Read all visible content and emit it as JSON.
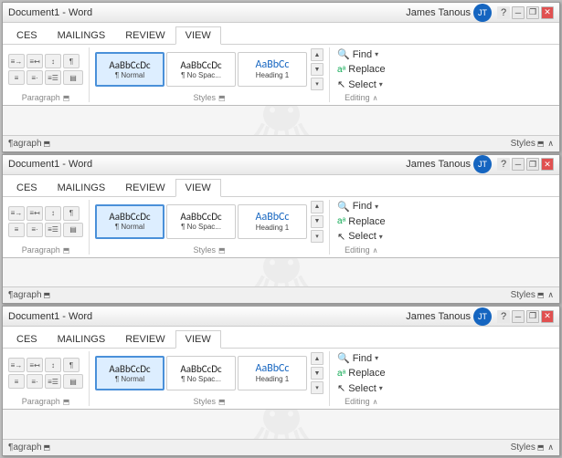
{
  "windows": [
    {
      "id": "window1",
      "title": "Document1 - Word",
      "user": "James Tanous",
      "tabs": [
        "CES",
        "MAILINGS",
        "REVIEW",
        "VIEW"
      ],
      "activeTab": "VIEW",
      "styles": [
        {
          "label": "¶ Normal",
          "sample": "AaBbCcDc",
          "active": true
        },
        {
          "label": "¶ No Spac...",
          "sample": "AaBbCcDc",
          "active": false
        },
        {
          "label": "Heading 1",
          "sample": "AaBbCc",
          "active": false
        }
      ],
      "editing": {
        "find": "🔍 Find",
        "replace": "Replace",
        "select": "Select"
      },
      "statusLeft": "¶agraph",
      "statusRight": "Styles"
    },
    {
      "id": "window2",
      "title": "Document1 - Word",
      "user": "James Tanous",
      "tabs": [
        "CES",
        "MAILINGS",
        "REVIEW",
        "VIEW"
      ],
      "activeTab": "VIEW",
      "styles": [
        {
          "label": "¶ Normal",
          "sample": "AaBbCcDc",
          "active": true
        },
        {
          "label": "¶ No Spac...",
          "sample": "AaBbCcDc",
          "active": false
        },
        {
          "label": "Heading 1",
          "sample": "AaBbCc",
          "active": false
        }
      ],
      "editing": {
        "find": "🔍 Find",
        "replace": "Replace",
        "select": "Select"
      },
      "statusLeft": "¶agraph",
      "statusRight": "Styles"
    },
    {
      "id": "window3",
      "title": "Document1 - Word",
      "user": "James Tanous",
      "tabs": [
        "CES",
        "MAILINGS",
        "REVIEW",
        "VIEW"
      ],
      "activeTab": "VIEW",
      "styles": [
        {
          "label": "¶ Normal",
          "sample": "AaBbCcDc",
          "active": true
        },
        {
          "label": "¶ No Spac...",
          "sample": "AaBbCcDc",
          "active": false
        },
        {
          "label": "Heading 1",
          "sample": "AaBbCc",
          "active": false
        }
      ],
      "editing": {
        "find": "🔍 Find",
        "replace": "Replace",
        "select": "Select"
      },
      "statusLeft": "¶agraph",
      "statusRight": "Styles"
    }
  ],
  "icons": {
    "minimize": "─",
    "restore": "❐",
    "close": "✕",
    "help": "?",
    "scroll_up": "▲",
    "scroll_down": "▼",
    "scroll_more": "▾",
    "find_icon": "🔍",
    "replace_icon": "aᵃ",
    "select_icon": "↖",
    "para_icon": "¶",
    "sort_icon": "↕",
    "indent_icon": "≡",
    "chevron_down": "▾"
  }
}
